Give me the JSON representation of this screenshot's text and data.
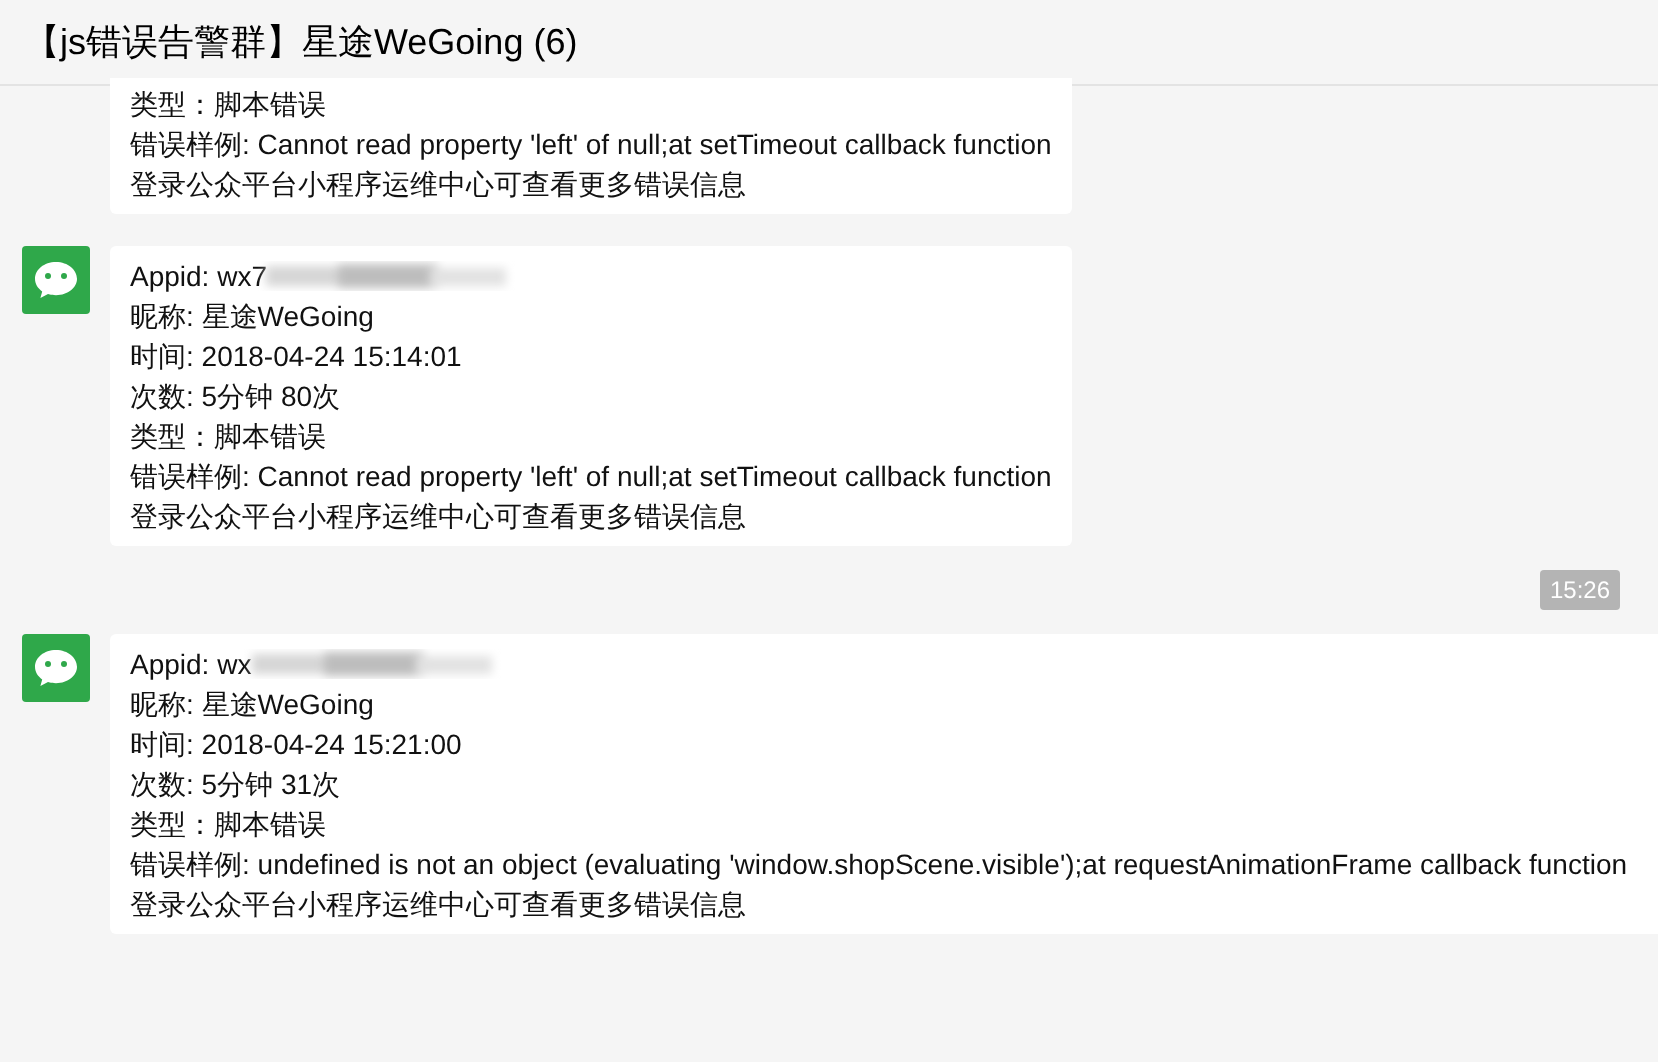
{
  "window": {
    "title": "【js错误告警群】星途WeGoing (6)"
  },
  "messages": [
    {
      "kind": "message",
      "avatar": false,
      "wide": false,
      "lines": [
        {
          "text": "类型：脚本错误"
        },
        {
          "text": "错误样例: Cannot read property 'left' of null;at setTimeout callback function"
        },
        {
          "text": "登录公众平台小程序运维中心可查看更多错误信息"
        }
      ]
    },
    {
      "kind": "message",
      "avatar": true,
      "wide": false,
      "lines": [
        {
          "text": "Appid: wx7",
          "redacted": true
        },
        {
          "text": "昵称: 星途WeGoing"
        },
        {
          "text": "时间: 2018-04-24 15:14:01"
        },
        {
          "text": "次数: 5分钟 80次"
        },
        {
          "text": "类型：脚本错误"
        },
        {
          "text": "错误样例: Cannot read property 'left' of null;at setTimeout callback function"
        },
        {
          "text": "登录公众平台小程序运维中心可查看更多错误信息"
        }
      ]
    },
    {
      "kind": "timestamp",
      "text": "15:26"
    },
    {
      "kind": "message",
      "avatar": true,
      "wide": true,
      "lines": [
        {
          "text": "Appid: wx",
          "redacted": true
        },
        {
          "text": "昵称: 星途WeGoing"
        },
        {
          "text": "时间: 2018-04-24 15:21:00"
        },
        {
          "text": "次数: 5分钟 31次"
        },
        {
          "text": "类型：脚本错误"
        },
        {
          "text": "错误样例: undefined is not an object (evaluating 'window.shopScene.visible');at requestAnimationFrame callback function"
        },
        {
          "text": "登录公众平台小程序运维中心可查看更多错误信息"
        }
      ]
    }
  ]
}
